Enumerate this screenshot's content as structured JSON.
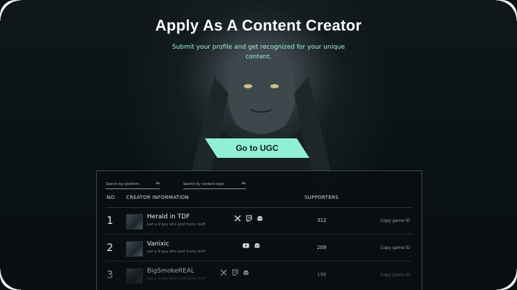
{
  "hero": {
    "title": "Apply As A Content Creator",
    "subtitle": "Submit your profile and get recognized for your unique content.",
    "cta_label": "Go to UGC"
  },
  "colors": {
    "accent": "#8ff0d4",
    "background": "#0b1214"
  },
  "filters": {
    "platform_placeholder": "Search by platform",
    "content_type_placeholder": "Search by content type"
  },
  "table": {
    "headers": {
      "no": "NO.",
      "creator": "CREATOR INFORMATION",
      "supporters": "SUPPORTERS"
    },
    "rows": [
      {
        "rank": "1",
        "name": "Herald in TDF",
        "description": "Just a lil guy who post funny stuff",
        "platforms": [
          "x-icon",
          "twitch-icon",
          "discord-icon"
        ],
        "supporters": "312",
        "action": "Copy game ID"
      },
      {
        "rank": "2",
        "name": "Vanixic",
        "description": "Just a lil guy who post funny stuff",
        "platforms": [
          "youtube-icon",
          "discord-icon"
        ],
        "supporters": "209",
        "action": "Copy game ID"
      },
      {
        "rank": "3",
        "name": "BigSmokeREAL",
        "description": "Just a lil guy who post funny stuff",
        "platforms": [
          "x-icon",
          "twitch-icon",
          "discord-icon"
        ],
        "supporters": "196",
        "action": "Copy game ID"
      }
    ]
  }
}
